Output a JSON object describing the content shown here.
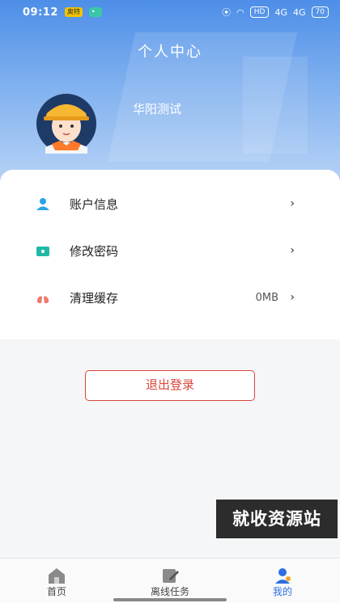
{
  "status_bar": {
    "time": "09:12",
    "badge_yellow": "奥特",
    "signal_1": "4G",
    "signal_2": "4G",
    "hd": "HD",
    "battery": "70"
  },
  "header": {
    "title": "个人中心",
    "username": "华阳测试"
  },
  "menu": [
    {
      "label": "账户信息",
      "value": "",
      "icon": "user-icon",
      "icon_color": "#2aa3e8"
    },
    {
      "label": "修改密码",
      "value": "",
      "icon": "lock-icon",
      "icon_color": "#22b8a8"
    },
    {
      "label": "清理缓存",
      "value": "0MB",
      "icon": "lungs-icon",
      "icon_color": "#f07a6a"
    }
  ],
  "logout_label": "退出登录",
  "watermark": "就收资源站",
  "tabs": [
    {
      "label": "首页",
      "icon": "home-icon"
    },
    {
      "label": "离线任务",
      "icon": "edit-icon"
    },
    {
      "label": "我的",
      "icon": "person-icon",
      "active": true
    }
  ],
  "colors": {
    "accent": "#2f6fe0",
    "logout": "#d9463a"
  }
}
